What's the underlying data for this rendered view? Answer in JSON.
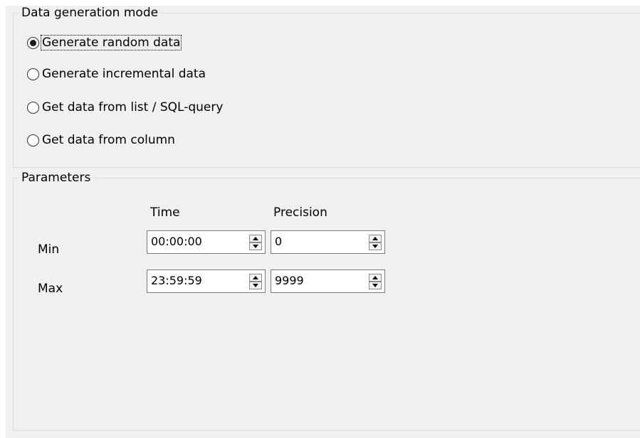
{
  "data_generation_group": {
    "title": "Data generation mode",
    "options": [
      {
        "label": "Generate random data",
        "selected": true
      },
      {
        "label": "Generate incremental data",
        "selected": false
      },
      {
        "label": "Get data from list / SQL-query",
        "selected": false
      },
      {
        "label": "Get data from column",
        "selected": false
      }
    ]
  },
  "parameters_group": {
    "title": "Parameters",
    "column_headers": {
      "time": "Time",
      "precision": "Precision"
    },
    "rows": [
      {
        "label": "Min",
        "time": "00:00:00",
        "precision": "0"
      },
      {
        "label": "Max",
        "time": "23:59:59",
        "precision": "9999"
      }
    ]
  },
  "colors": {
    "panel_background": "#f0f0f0",
    "group_border": "#dcdcdc",
    "input_border": "#7a7a7a"
  }
}
